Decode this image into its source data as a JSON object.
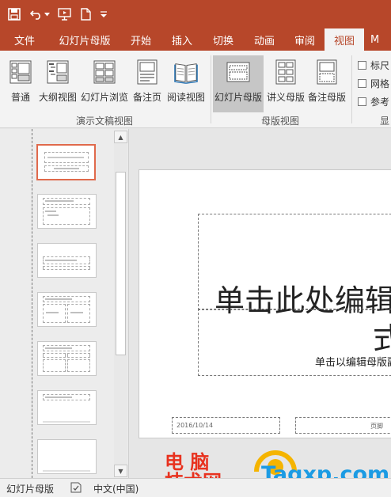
{
  "quick_access": {
    "icons": [
      "save-icon",
      "undo-icon",
      "dropdown-arrow-icon",
      "slideshow-from-start-icon",
      "new-file-icon",
      "customize-toolbar-icon"
    ]
  },
  "tabs": [
    {
      "label": "文件",
      "active": false
    },
    {
      "label": "幻灯片母版",
      "active": false
    },
    {
      "label": "开始",
      "active": false
    },
    {
      "label": "插入",
      "active": false
    },
    {
      "label": "切换",
      "active": false
    },
    {
      "label": "动画",
      "active": false
    },
    {
      "label": "审阅",
      "active": false
    },
    {
      "label": "视图",
      "active": true
    },
    {
      "label": "M",
      "active": false
    }
  ],
  "ribbon": {
    "presentation_views": {
      "label": "演示文稿视图",
      "buttons": [
        {
          "label": "普通",
          "icon": "normal-view-icon"
        },
        {
          "label": "大纲视图",
          "icon": "outline-view-icon"
        },
        {
          "label": "幻灯片浏览",
          "icon": "slide-sorter-icon"
        },
        {
          "label": "备注页",
          "icon": "notes-page-icon"
        },
        {
          "label": "阅读视图",
          "icon": "reading-view-icon"
        }
      ]
    },
    "master_views": {
      "label": "母版视图",
      "buttons": [
        {
          "label": "幻灯片母版",
          "icon": "slide-master-icon",
          "selected": true
        },
        {
          "label": "讲义母版",
          "icon": "handout-master-icon"
        },
        {
          "label": "备注母版",
          "icon": "notes-master-icon"
        }
      ]
    },
    "show": {
      "label": "显",
      "checkboxes": [
        {
          "label": "标尺",
          "checked": false
        },
        {
          "label": "网格",
          "checked": false
        },
        {
          "label": "参考",
          "checked": false
        }
      ]
    }
  },
  "slide": {
    "title": "单击此处编辑",
    "title_line2": "式",
    "subtitle": "单击以编辑母版副",
    "date": "2016/10/14",
    "footer": "页脚"
  },
  "watermark": {
    "chinese": "电 脑\n技术网",
    "english": "Tagxp.com"
  },
  "status_bar": {
    "view_name": "幻灯片母版",
    "language": "中文(中国)"
  },
  "colors": {
    "accent": "#b7472a",
    "ribbon_bg": "#f3f3f3",
    "selected_thumb_border": "#e0694b"
  }
}
